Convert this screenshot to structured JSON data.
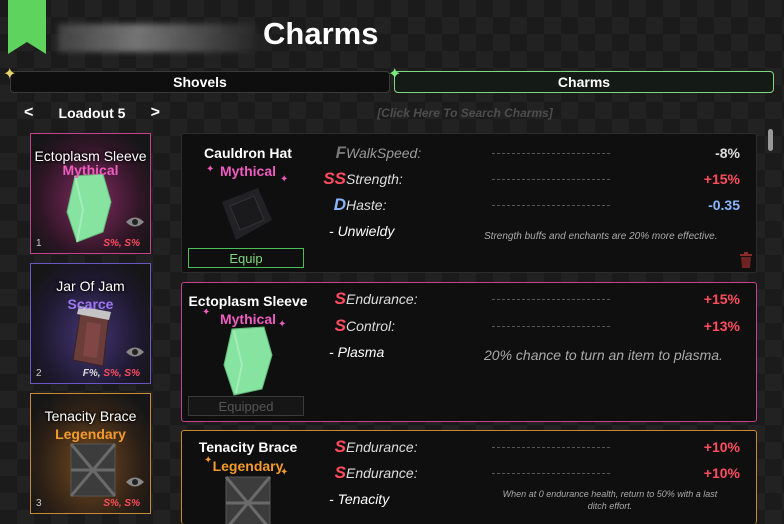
{
  "header": {
    "title": "Charms"
  },
  "tabs": [
    {
      "label": "Shovels",
      "active": false
    },
    {
      "label": "Charms",
      "active": true
    }
  ],
  "loadout": {
    "prev": "<",
    "label": "Loadout 5",
    "next": ">"
  },
  "search": {
    "placeholder": "[Click Here To Search Charms]"
  },
  "colors": {
    "mythical": "#f05cc0",
    "scarce": "#9a78f2",
    "legendary": "#f59a2d",
    "stat_red": "#ff4d5e",
    "stat_blue": "#8ab6ff",
    "accent_green": "#7ed87e"
  },
  "loadout_cards": [
    {
      "name": "Ectoplasm Sleeve",
      "rarity": "Mythical",
      "slot": "1",
      "stats": "S%, S%",
      "icon": "ectoplasm-sleeve-icon"
    },
    {
      "name": "Jar Of Jam",
      "rarity": "Scarce",
      "slot": "2",
      "stats_f": "F%",
      "stats": "S%, S%",
      "icon": "jar-of-jam-icon"
    },
    {
      "name": "Tenacity Brace",
      "rarity": "Legendary",
      "slot": "3",
      "stats": "S%, S%",
      "icon": "tenacity-brace-icon"
    }
  ],
  "charms": [
    {
      "name": "Cauldron Hat",
      "rarity": "Mythical",
      "button": "Equip",
      "equipped": false,
      "stats": [
        {
          "grade": "F",
          "label": "WalkSpeed:",
          "value": "-8%"
        },
        {
          "grade": "SS",
          "label": "Strength:",
          "value": "+15%"
        },
        {
          "grade": "D",
          "label": "Haste:",
          "value": "-0.35"
        }
      ],
      "ability": "Unwieldy",
      "ability_desc": "Strength buffs and enchants are 20% more effective."
    },
    {
      "name": "Ectoplasm Sleeve",
      "rarity": "Mythical",
      "button": "Equipped",
      "equipped": true,
      "stats": [
        {
          "grade": "S",
          "label": "Endurance:",
          "value": "+15%"
        },
        {
          "grade": "S",
          "label": "Control:",
          "value": "+13%"
        }
      ],
      "ability": "Plasma",
      "ability_desc": "20% chance to turn an item to plasma."
    },
    {
      "name": "Tenacity Brace",
      "rarity": "Legendary",
      "stats": [
        {
          "grade": "S",
          "label": "Endurance:",
          "value": "+10%"
        },
        {
          "grade": "S",
          "label": "Endurance:",
          "value": "+10%"
        }
      ],
      "ability": "Tenacity",
      "ability_desc_1": "When at 0 endurance health, return to 50% with a last",
      "ability_desc_2": "ditch effort."
    }
  ]
}
